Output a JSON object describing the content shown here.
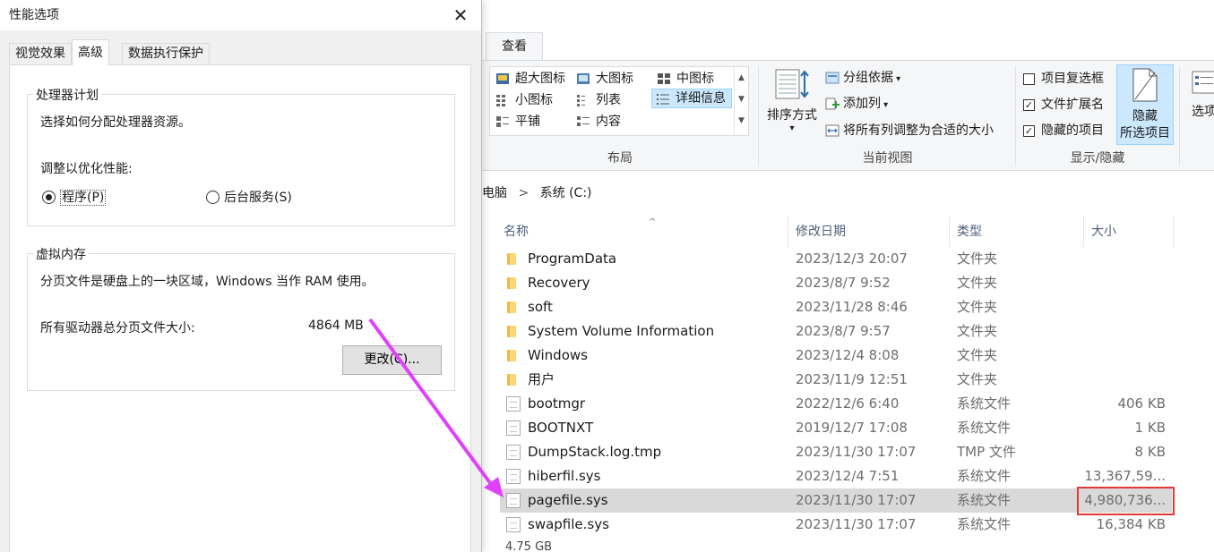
{
  "dialog": {
    "title": "性能选项",
    "tabs": [
      "视觉效果",
      "高级",
      "数据执行保护"
    ],
    "processor": {
      "group_title": "处理器计划",
      "description": "选择如何分配处理器资源。",
      "adjust_label": "调整以优化性能:",
      "option_programs": "程序(P)",
      "option_services": "后台服务(S)"
    },
    "virtual_memory": {
      "group_title": "虚拟内存",
      "description": "分页文件是硬盘上的一块区域，Windows 当作 RAM 使用。",
      "total_label": "所有驱动器总分页文件大小:",
      "total_value": "4864 MB",
      "change_button": "更改(C)..."
    }
  },
  "explorer": {
    "ribbon": {
      "active_tab": "查看",
      "layout": {
        "items": [
          "超大图标",
          "大图标",
          "中图标",
          "小图标",
          "列表",
          "详细信息",
          "平铺",
          "内容"
        ],
        "label": "布局"
      },
      "current_view": {
        "sort_by": "排序方式",
        "group_by": "分组依据",
        "add_columns": "添加列",
        "fit_columns": "将所有列调整为合适的大小",
        "label": "当前视图"
      },
      "show_hide": {
        "item_checkboxes": "项目复选框",
        "file_extensions": "文件扩展名",
        "hidden_items": "隐藏的项目",
        "hide_selected_line1": "隐藏",
        "hide_selected_line2": "所选项目",
        "label": "显示/隐藏"
      },
      "options_partial": "选项"
    },
    "address": {
      "crumb1": "电脑",
      "separator": ">",
      "crumb2": "系统 (C:)"
    },
    "columns": [
      "名称",
      "修改日期",
      "类型",
      "大小"
    ],
    "files": [
      {
        "name": "ProgramData",
        "date": "2023/12/3 20:07",
        "type": "文件夹",
        "size": "",
        "kind": "folder"
      },
      {
        "name": "Recovery",
        "date": "2023/8/7 9:52",
        "type": "文件夹",
        "size": "",
        "kind": "folder"
      },
      {
        "name": "soft",
        "date": "2023/11/28 8:46",
        "type": "文件夹",
        "size": "",
        "kind": "folder"
      },
      {
        "name": "System Volume Information",
        "date": "2023/8/7 9:57",
        "type": "文件夹",
        "size": "",
        "kind": "folder"
      },
      {
        "name": "Windows",
        "date": "2023/12/4 8:08",
        "type": "文件夹",
        "size": "",
        "kind": "folder"
      },
      {
        "name": "用户",
        "date": "2023/11/9 12:51",
        "type": "文件夹",
        "size": "",
        "kind": "folder"
      },
      {
        "name": "bootmgr",
        "date": "2022/12/6 6:40",
        "type": "系统文件",
        "size": "406 KB",
        "kind": "file"
      },
      {
        "name": "BOOTNXT",
        "date": "2019/12/7 17:08",
        "type": "系统文件",
        "size": "1 KB",
        "kind": "file"
      },
      {
        "name": "DumpStack.log.tmp",
        "date": "2023/11/30 17:07",
        "type": "TMP 文件",
        "size": "8 KB",
        "kind": "file"
      },
      {
        "name": "hiberfil.sys",
        "date": "2023/12/4 7:51",
        "type": "系统文件",
        "size": "13,367,59...",
        "kind": "file"
      },
      {
        "name": "pagefile.sys",
        "date": "2023/11/30 17:07",
        "type": "系统文件",
        "size": "4,980,736...",
        "kind": "file",
        "selected": true
      },
      {
        "name": "swapfile.sys",
        "date": "2023/11/30 17:07",
        "type": "系统文件",
        "size": "16,384 KB",
        "kind": "file"
      }
    ],
    "status_partial": "4.75 GB"
  },
  "colors": {
    "annotation_arrow": "#e040fb",
    "highlight_box": "#e53935",
    "selection": "#d9d9d9",
    "ribbon_selected": "#cce8ff"
  }
}
